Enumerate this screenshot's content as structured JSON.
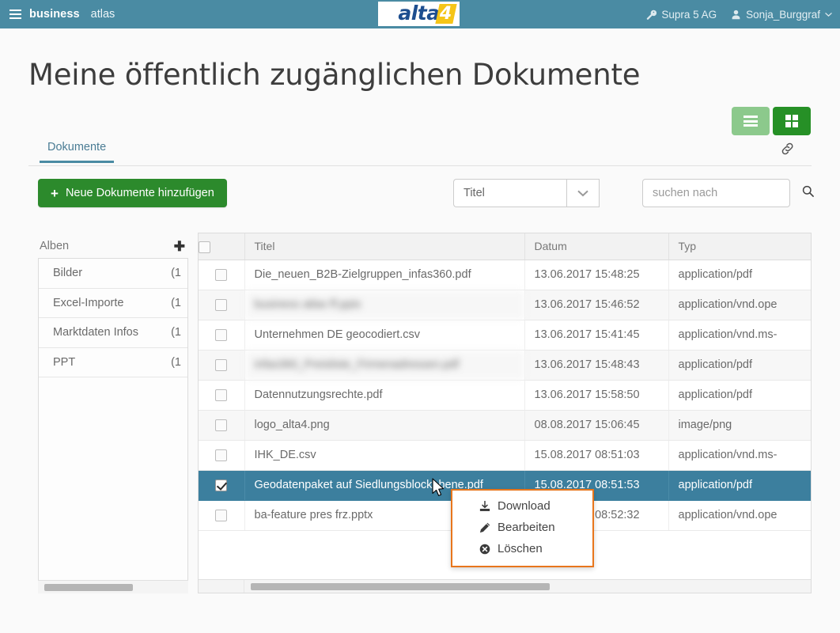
{
  "topbar": {
    "menu_icon": "hamburger-icon",
    "brand_strong": "business",
    "brand_light": "atlas",
    "logo_text": "alta",
    "logo_accent": "4",
    "org_icon": "wrench-icon",
    "org_name": "Supra 5 AG",
    "user_icon": "user-icon",
    "user_name": "Sonja_Burggraf",
    "user_caret": "chevron-down-icon",
    "bg_color": "#4a8ba3"
  },
  "page": {
    "title": "Meine öffentlich zugänglichen Dokumente"
  },
  "view_toggle": {
    "list_label": "list-view",
    "grid_label": "grid-view",
    "active": "grid",
    "list_color": "#8cc98c",
    "grid_color": "#269026"
  },
  "tabs": {
    "items": [
      {
        "label": "Dokumente",
        "active": true
      }
    ],
    "link_icon": "link-icon"
  },
  "toolbar": {
    "add_button": "Neue Dokumente hinzufügen",
    "add_icon": "plus-icon",
    "add_color": "#2c8a2c",
    "sort_field": "Titel",
    "sort_field_caret": "chevron-down-icon",
    "sort_direction_icon": "caret-up-icon",
    "search_placeholder": "suchen nach",
    "search_value": "",
    "search_icon": "search-icon"
  },
  "albums": {
    "title": "Alben",
    "add_icon": "plus-icon",
    "items": [
      {
        "label": "Bilder",
        "count": "(1"
      },
      {
        "label": "Excel-Importe",
        "count": "(1"
      },
      {
        "label": "Marktdaten Infos",
        "count": "(1"
      },
      {
        "label": "PPT",
        "count": "(1"
      }
    ]
  },
  "table": {
    "columns": [
      "",
      "Titel",
      "Datum",
      "Typ"
    ],
    "select_all_checked": false,
    "rows": [
      {
        "checked": false,
        "title": "Die_neuen_B2B-Zielgruppen_infas360.pdf",
        "blurred": false,
        "date": "13.06.2017 15:48:25",
        "type": "application/pdf",
        "selected": false
      },
      {
        "checked": false,
        "title": "business atlas ff.pptx",
        "blurred": true,
        "date": "13.06.2017 15:46:52",
        "type": "application/vnd.ope",
        "selected": false
      },
      {
        "checked": false,
        "title": "Unternehmen DE geocodiert.csv",
        "blurred": false,
        "date": "13.06.2017 15:41:45",
        "type": "application/vnd.ms-",
        "selected": false
      },
      {
        "checked": false,
        "title": "infas360_Preisliste_Firmenadressen.pdf",
        "blurred": true,
        "date": "13.06.2017 15:48:43",
        "type": "application/pdf",
        "selected": false
      },
      {
        "checked": false,
        "title": "Datennutzungsrechte.pdf",
        "blurred": false,
        "date": "13.06.2017 15:58:50",
        "type": "application/pdf",
        "selected": false
      },
      {
        "checked": false,
        "title": "logo_alta4.png",
        "blurred": false,
        "date": "08.08.2017 15:06:45",
        "type": "image/png",
        "selected": false
      },
      {
        "checked": false,
        "title": "IHK_DE.csv",
        "blurred": false,
        "date": "15.08.2017 08:51:03",
        "type": "application/vnd.ms-",
        "selected": false
      },
      {
        "checked": true,
        "title": "Geodatenpaket auf Siedlungsblockebene.pdf",
        "blurred": false,
        "date": "15.08.2017 08:51:53",
        "type": "application/pdf",
        "selected": true
      },
      {
        "checked": false,
        "title": "ba-feature pres frz.pptx",
        "blurred": false,
        "date": "15.08.2017 08:52:32",
        "type": "application/vnd.ope",
        "selected": false
      }
    ],
    "selected_row_color": "#3c7f9e"
  },
  "context_menu": {
    "border_color": "#e8761c",
    "items": [
      {
        "label": "Download",
        "icon": "download-icon"
      },
      {
        "label": "Bearbeiten",
        "icon": "pencil-icon"
      },
      {
        "label": "Löschen",
        "icon": "delete-circle-icon"
      }
    ]
  }
}
